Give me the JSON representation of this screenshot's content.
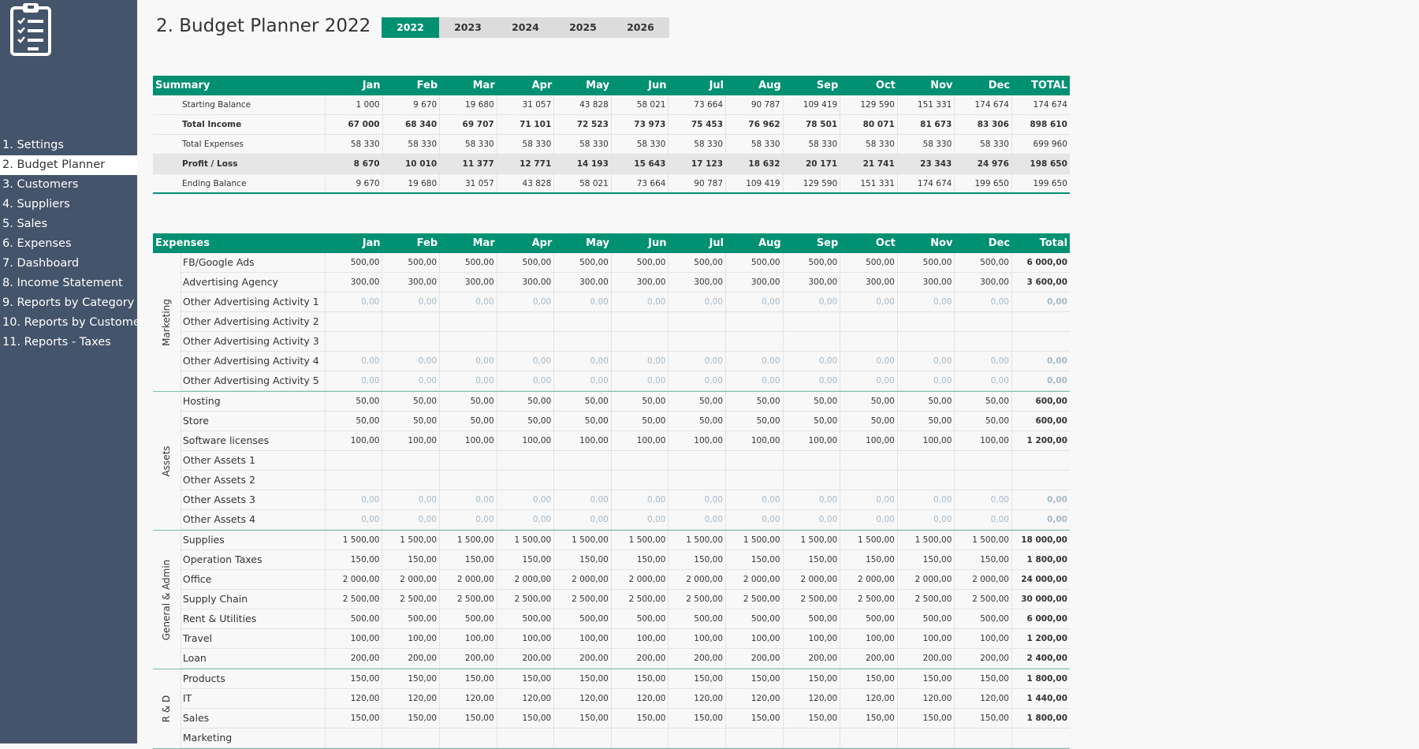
{
  "page_title": "2. Budget Planner 2022",
  "years": [
    "2022",
    "2023",
    "2024",
    "2025",
    "2026"
  ],
  "active_year": 0,
  "nav": [
    "1. Settings",
    "2. Budget Planner",
    "3. Customers",
    "4. Suppliers",
    "5. Sales",
    "6. Expenses",
    "7. Dashboard",
    "8. Income Statement",
    "9. Reports by Category",
    "10. Reports by Customer",
    "11. Reports - Taxes"
  ],
  "active_nav": 1,
  "months": [
    "Jan",
    "Feb",
    "Mar",
    "Apr",
    "May",
    "Jun",
    "Jul",
    "Aug",
    "Sep",
    "Oct",
    "Nov",
    "Dec"
  ],
  "summary": {
    "title": "Summary",
    "total_label": "TOTAL",
    "rows": [
      {
        "label": "Starting Balance",
        "values": [
          "1 000",
          "9 670",
          "19 680",
          "31 057",
          "43 828",
          "58 021",
          "73 664",
          "90 787",
          "109 419",
          "129 590",
          "151 331",
          "174 674"
        ],
        "total": "174 674"
      },
      {
        "label": "Total Income",
        "values": [
          "67 000",
          "68 340",
          "69 707",
          "71 101",
          "72 523",
          "73 973",
          "75 453",
          "76 962",
          "78 501",
          "80 071",
          "81 673",
          "83 306"
        ],
        "total": "898 610"
      },
      {
        "label": "Total Expenses",
        "values": [
          "58 330",
          "58 330",
          "58 330",
          "58 330",
          "58 330",
          "58 330",
          "58 330",
          "58 330",
          "58 330",
          "58 330",
          "58 330",
          "58 330"
        ],
        "total": "699 960"
      },
      {
        "label": "Profit / Loss",
        "values": [
          "8 670",
          "10 010",
          "11 377",
          "12 771",
          "14 193",
          "15 643",
          "17 123",
          "18 632",
          "20 171",
          "21 741",
          "23 343",
          "24 976"
        ],
        "total": "198 650"
      },
      {
        "label": "Ending Balance",
        "values": [
          "9 670",
          "19 680",
          "31 057",
          "43 828",
          "58 021",
          "73 664",
          "90 787",
          "109 419",
          "129 590",
          "151 331",
          "174 674",
          "199 650"
        ],
        "total": "199 650"
      }
    ]
  },
  "expenses": {
    "title": "Expenses",
    "total_label": "Total",
    "groups": [
      {
        "name": "Marketing",
        "rows": [
          {
            "label": "FB/Google Ads",
            "value": "500,00",
            "total": "6 000,00"
          },
          {
            "label": "Advertising Agency",
            "value": "300,00",
            "total": "3 600,00"
          },
          {
            "label": "Other Advertising Activity 1",
            "value": "0,00",
            "total": "0,00"
          },
          {
            "label": "Other Advertising Activity 2",
            "value": "",
            "total": ""
          },
          {
            "label": "Other Advertising Activity 3",
            "value": "",
            "total": ""
          },
          {
            "label": "Other Advertising Activity 4",
            "value": "0,00",
            "total": "0,00"
          },
          {
            "label": "Other Advertising Activity 5",
            "value": "0,00",
            "total": "0,00"
          }
        ]
      },
      {
        "name": "Assets",
        "rows": [
          {
            "label": "Hosting",
            "value": "50,00",
            "total": "600,00"
          },
          {
            "label": "Store",
            "value": "50,00",
            "total": "600,00"
          },
          {
            "label": "Software licenses",
            "value": "100,00",
            "total": "1 200,00"
          },
          {
            "label": "Other Assets 1",
            "value": "",
            "total": ""
          },
          {
            "label": "Other Assets 2",
            "value": "",
            "total": ""
          },
          {
            "label": "Other Assets 3",
            "value": "0,00",
            "total": "0,00"
          },
          {
            "label": "Other Assets 4",
            "value": "0,00",
            "total": "0,00"
          }
        ]
      },
      {
        "name": "General & Admin",
        "rows": [
          {
            "label": "Supplies",
            "value": "1 500,00",
            "total": "18 000,00"
          },
          {
            "label": "Operation Taxes",
            "value": "150,00",
            "total": "1 800,00"
          },
          {
            "label": "Office",
            "value": "2 000,00",
            "total": "24 000,00"
          },
          {
            "label": "Supply Chain",
            "value": "2 500,00",
            "total": "30 000,00"
          },
          {
            "label": "Rent & Utilities",
            "value": "500,00",
            "total": "6 000,00"
          },
          {
            "label": "Travel",
            "value": "100,00",
            "total": "1 200,00"
          },
          {
            "label": "Loan",
            "value": "200,00",
            "total": "2 400,00"
          }
        ]
      },
      {
        "name": "R & D",
        "rows": [
          {
            "label": "Products",
            "value": "150,00",
            "total": "1 800,00"
          },
          {
            "label": "IT",
            "value": "120,00",
            "total": "1 440,00"
          },
          {
            "label": "Sales",
            "value": "150,00",
            "total": "1 800,00"
          },
          {
            "label": "Marketing",
            "value": "",
            "total": ""
          }
        ]
      }
    ]
  },
  "colors": {
    "accent": "#009072",
    "sidebar": "#44546a",
    "muted": "#a5b8c8"
  }
}
